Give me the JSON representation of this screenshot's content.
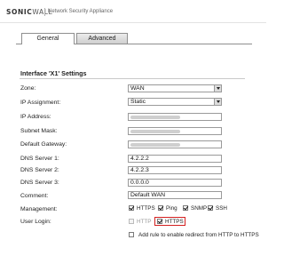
{
  "header": {
    "brand_bold": "SONIC",
    "brand_rest": "WALL",
    "product": "Network Security Appliance"
  },
  "tabs": [
    {
      "label": "General",
      "active": true
    },
    {
      "label": "Advanced",
      "active": false
    }
  ],
  "section_title": "Interface 'X1' Settings",
  "fields": {
    "zone": {
      "label": "Zone:",
      "value": "WAN"
    },
    "ip_assignment": {
      "label": "IP Assignment:",
      "value": "Static"
    },
    "ip_address": {
      "label": "IP Address:"
    },
    "subnet_mask": {
      "label": "Subnet Mask:"
    },
    "default_gateway": {
      "label": "Default Gateway:"
    },
    "dns1": {
      "label": "DNS Server 1:",
      "value": "4.2.2.2"
    },
    "dns2": {
      "label": "DNS Server 2:",
      "value": "4.2.2.3"
    },
    "dns3": {
      "label": "DNS Server 3:",
      "value": "0.0.0.0"
    },
    "comment": {
      "label": "Comment:",
      "value": "Default WAN"
    }
  },
  "management": {
    "label": "Management:",
    "options": [
      {
        "label": "HTTPS",
        "checked": true
      },
      {
        "label": "Ping",
        "checked": true
      },
      {
        "label": "SNMP",
        "checked": true
      },
      {
        "label": "SSH",
        "checked": true
      }
    ]
  },
  "user_login": {
    "label": "User Login:",
    "options": [
      {
        "label": "HTTP",
        "checked": false,
        "disabled": true
      },
      {
        "label": "HTTPS",
        "checked": true,
        "disabled": false
      }
    ]
  },
  "redirect": {
    "label": "Add rule to enable redirect from HTTP to HTTPS",
    "checked": false
  },
  "colors": {
    "highlight": "#d42020",
    "tab_border": "#8f8f8f"
  }
}
